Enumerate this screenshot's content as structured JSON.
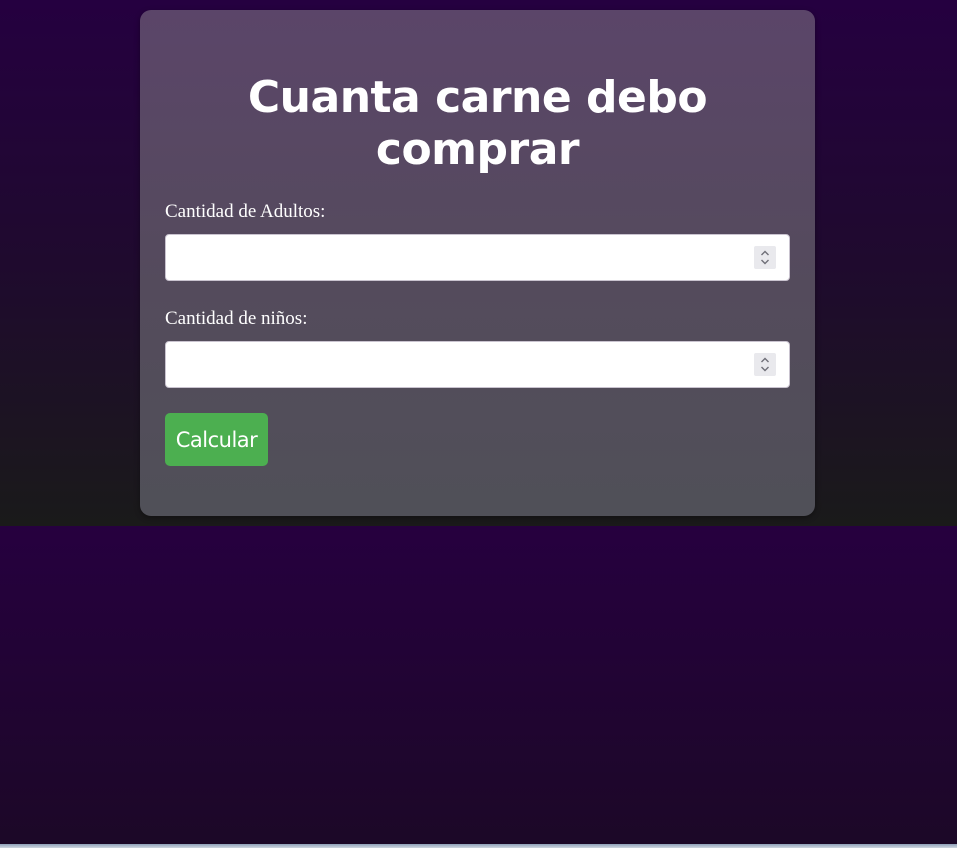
{
  "page": {
    "title": "Cuanta carne debo comprar"
  },
  "form": {
    "adults_label": "Cantidad de Adultos:",
    "adults_value": "",
    "kids_label": "Cantidad de niños:",
    "kids_value": "",
    "submit_label": "Calcular"
  },
  "colors": {
    "button": "#4caf50",
    "card": "#5b4569",
    "background": "#250040"
  },
  "icons": {
    "spinner": "chevron-up-down-icon"
  }
}
